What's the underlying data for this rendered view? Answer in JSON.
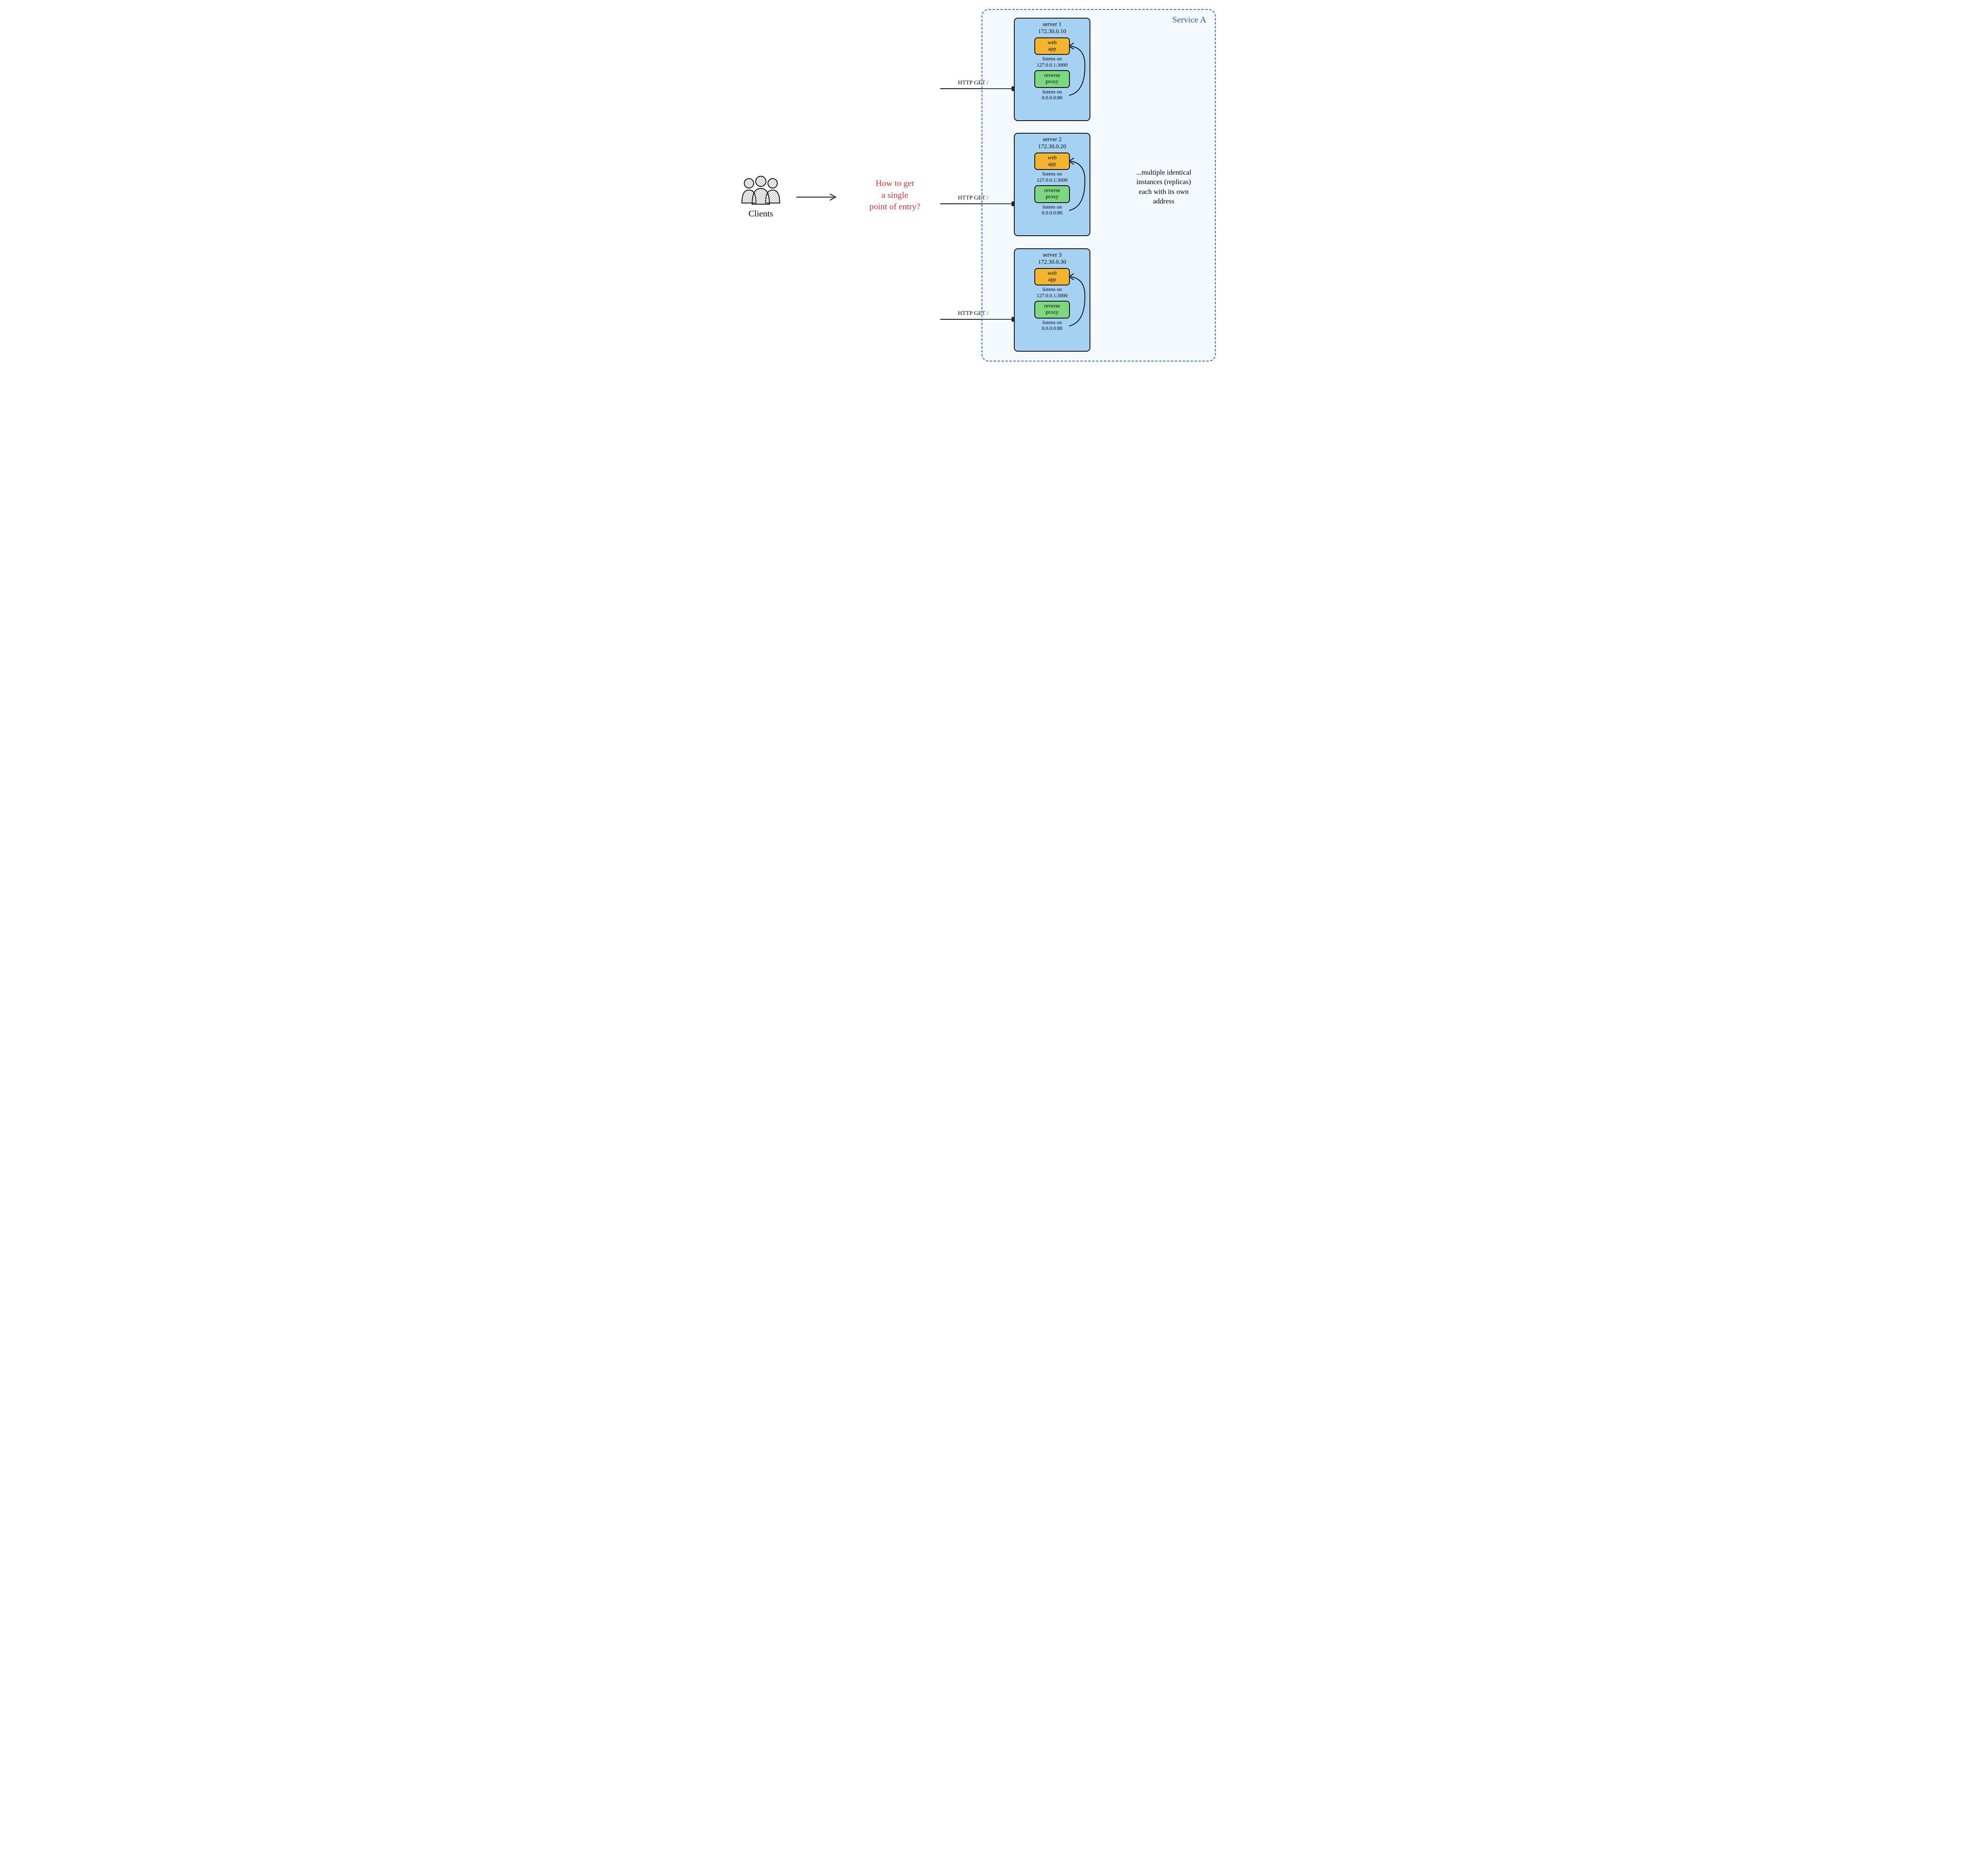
{
  "clients_label": "Clients",
  "question_line1": "How to get",
  "question_line2": "a single",
  "question_line3": "point of entry?",
  "service_title": "Service A",
  "service_note_line1": "...multiple identical",
  "service_note_line2": "instances (replicas)",
  "service_note_line3": "each with its own",
  "service_note_line4": "address",
  "http_get": "HTTP GET /",
  "servers": [
    {
      "name": "server 1",
      "ip": "172.30.0.10",
      "webapp": "web\napp",
      "webapp_listens": "listens on\n127.0.0.1:3000",
      "proxy": "reverse\nproxy",
      "proxy_listens": "listens on\n0.0.0.0:80"
    },
    {
      "name": "server 2",
      "ip": "172.30.0.20",
      "webapp": "web\napp",
      "webapp_listens": "listens on\n127.0.0.1:3000",
      "proxy": "reverse\nproxy",
      "proxy_listens": "listens on\n0.0.0.0:80"
    },
    {
      "name": "server 3",
      "ip": "172.30.0.30",
      "webapp": "web\napp",
      "webapp_listens": "listens on\n127.0.0.1:3000",
      "proxy": "reverse\nproxy",
      "proxy_listens": "listens on\n0.0.0.0:80"
    }
  ],
  "chart_data": {
    "type": "diagram",
    "title": "Single point of entry problem with multiple replicas",
    "clients": "Clients",
    "question": "How to get a single point of entry?",
    "service": {
      "name": "Service A",
      "note": "...multiple identical instances (replicas) each with its own address",
      "servers": [
        {
          "name": "server 1",
          "ip": "172.30.0.10",
          "components": [
            {
              "name": "web app",
              "listens": "127.0.0.1:3000"
            },
            {
              "name": "reverse proxy",
              "listens": "0.0.0.0:80"
            }
          ]
        },
        {
          "name": "server 2",
          "ip": "172.30.0.20",
          "components": [
            {
              "name": "web app",
              "listens": "127.0.0.1:3000"
            },
            {
              "name": "reverse proxy",
              "listens": "0.0.0.0:80"
            }
          ]
        },
        {
          "name": "server 3",
          "ip": "172.30.0.30",
          "components": [
            {
              "name": "web app",
              "listens": "127.0.0.1:3000"
            },
            {
              "name": "reverse proxy",
              "listens": "0.0.0.0:80"
            }
          ]
        }
      ]
    },
    "requests": [
      "HTTP GET /",
      "HTTP GET /",
      "HTTP GET /"
    ]
  }
}
